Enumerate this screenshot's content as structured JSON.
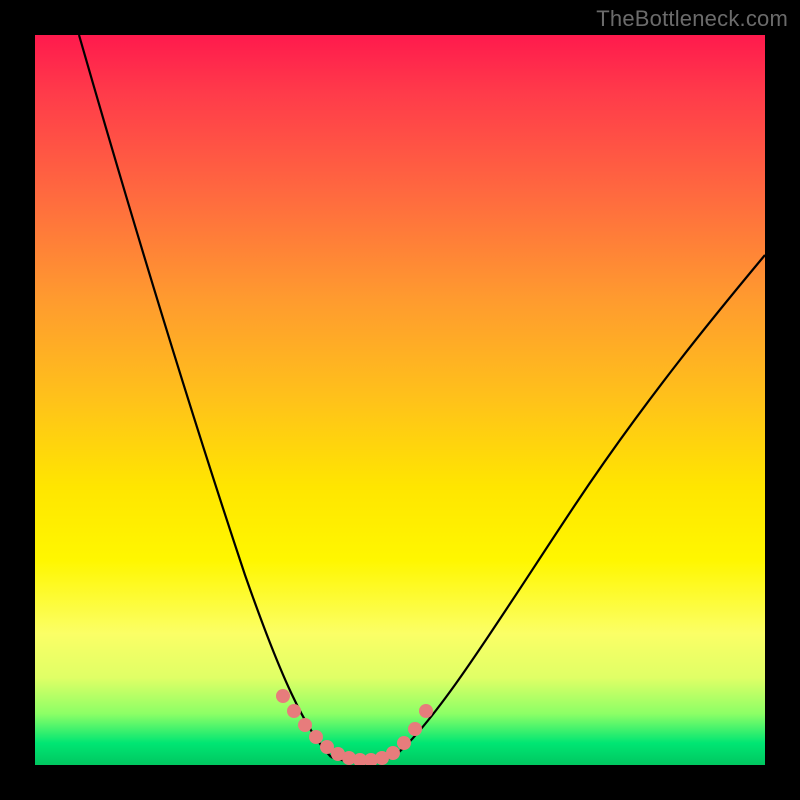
{
  "watermark": "TheBottleneck.com",
  "colors": {
    "background": "#000000",
    "gradient_top": "#ff1a4d",
    "gradient_mid": "#ffe600",
    "gradient_bottom": "#00c760",
    "curve": "#000000",
    "marker": "#e77c7c"
  },
  "chart_data": {
    "type": "line",
    "title": "",
    "xlabel": "",
    "ylabel": "",
    "xlim": [
      0,
      1
    ],
    "ylim": [
      0,
      1
    ],
    "notes": "No numeric axes or tick labels are present in the image. Values below are normalized 0–1 estimates read from pixel positions (0,0 = bottom-left of the colored plot area).",
    "series": [
      {
        "name": "left-curve",
        "x": [
          0.06,
          0.1,
          0.14,
          0.18,
          0.22,
          0.26,
          0.3,
          0.33,
          0.35,
          0.37,
          0.39,
          0.405
        ],
        "values": [
          1.0,
          0.84,
          0.69,
          0.55,
          0.42,
          0.3,
          0.19,
          0.11,
          0.07,
          0.04,
          0.02,
          0.01
        ]
      },
      {
        "name": "valley-floor",
        "x": [
          0.405,
          0.43,
          0.46,
          0.49
        ],
        "values": [
          0.01,
          0.005,
          0.005,
          0.01
        ]
      },
      {
        "name": "right-curve",
        "x": [
          0.49,
          0.52,
          0.56,
          0.62,
          0.7,
          0.78,
          0.86,
          0.94,
          1.0
        ],
        "values": [
          0.01,
          0.04,
          0.1,
          0.2,
          0.33,
          0.45,
          0.55,
          0.64,
          0.7
        ]
      }
    ],
    "markers": {
      "name": "highlighted-points",
      "color": "#e77c7c",
      "x": [
        0.34,
        0.355,
        0.37,
        0.385,
        0.4,
        0.415,
        0.43,
        0.445,
        0.46,
        0.475,
        0.49,
        0.505,
        0.52,
        0.535
      ],
      "values": [
        0.095,
        0.075,
        0.055,
        0.04,
        0.025,
        0.015,
        0.01,
        0.008,
        0.008,
        0.012,
        0.02,
        0.035,
        0.055,
        0.08
      ]
    }
  }
}
